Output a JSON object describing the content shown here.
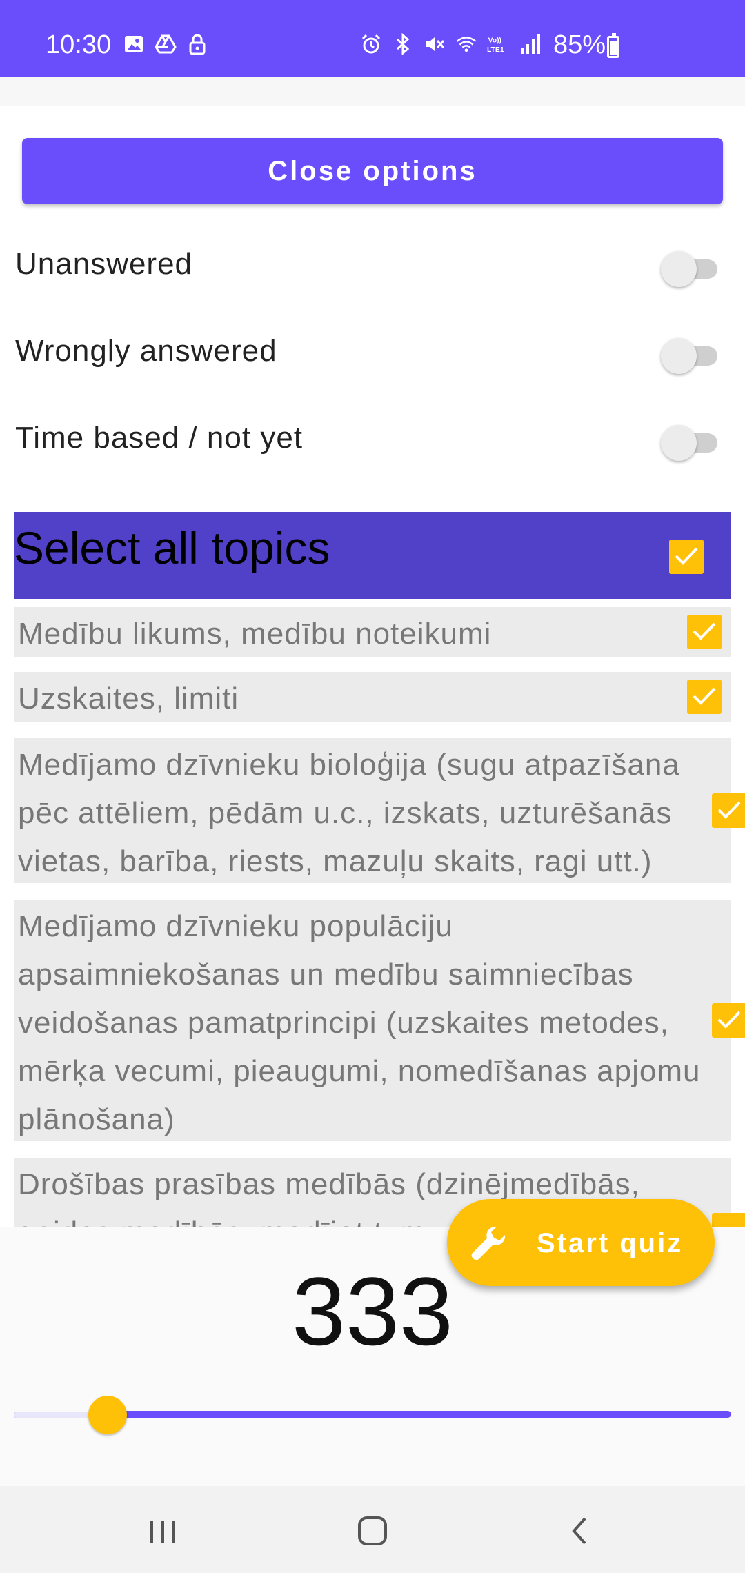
{
  "status_bar": {
    "time": "10:30",
    "battery": "85%",
    "left_icons": [
      "image-icon",
      "drive-icon",
      "lock-icon"
    ],
    "right_icons": [
      "alarm-icon",
      "bluetooth-icon",
      "mute-icon",
      "wifi-icon",
      "volte-icon",
      "signal-icon"
    ]
  },
  "options": {
    "close_label": "Close options",
    "toggles": [
      {
        "label": "Unanswered",
        "on": false
      },
      {
        "label": "Wrongly answered",
        "on": false
      },
      {
        "label": "Time based / not yet",
        "on": false
      }
    ]
  },
  "topics": {
    "select_all_label": "Select all topics",
    "select_all_checked": true,
    "items": [
      {
        "label": "Medību likums, medību noteikumi",
        "checked": true
      },
      {
        "label": "Uzskaites, limiti",
        "checked": true
      },
      {
        "label": "Medījamo dzīvnieku bioloģija (sugu atpazīšana pēc attēliem, pēdām u.c., izskats, uzturēšanās vietas, barība, riests, mazuļu skaits, ragi utt.)",
        "checked": true
      },
      {
        "label": "Medījamo dzīvnieku populāciju apsaimniekošanas un medību saimniecības veidošanas pamatprincipi (uzskaites metodes, mērķa vecumi, pieaugumi,  nomedīšanas apjomu plānošana)",
        "checked": true
      },
      {
        "label": "Drošības prasības medībās (dzinējmedībās, gaides medībās, medījot tum",
        "checked": true
      }
    ]
  },
  "quiz": {
    "start_label": "Start quiz",
    "question_count": "333",
    "slider_fraction": 0.12
  },
  "colors": {
    "primary": "#6a4dfb",
    "select_all_bg": "#5141c9",
    "accent": "#ffc107"
  }
}
